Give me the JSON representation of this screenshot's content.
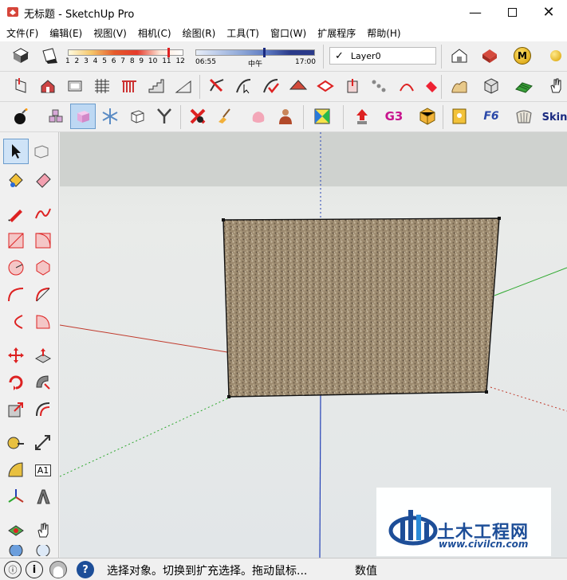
{
  "window": {
    "title": "无标题 - SketchUp Pro",
    "minimize_icon": "minimize-icon",
    "maximize_icon": "maximize-icon",
    "close_icon": "close-icon"
  },
  "menu": {
    "items": [
      "文件(F)",
      "编辑(E)",
      "视图(V)",
      "相机(C)",
      "绘图(R)",
      "工具(T)",
      "窗口(W)",
      "扩展程序",
      "帮助(H)"
    ]
  },
  "shadows": {
    "month_ticks": [
      "1",
      "2",
      "3",
      "4",
      "5",
      "6",
      "7",
      "8",
      "9",
      "10",
      "11",
      "12"
    ],
    "time_start": "06:55",
    "time_mid": "中午",
    "time_end": "17:00"
  },
  "layers": {
    "current": "Layer0",
    "checked": true
  },
  "toolbar_badges": {
    "m_badge": "M",
    "skin_badge": "Skin",
    "g3_badge": "G3",
    "f6_badge": "F6"
  },
  "palette": {
    "text_tool_label": "A1"
  },
  "status": {
    "message": "选择对象。切换到扩充选择。拖动鼠标...",
    "measure_label": "数值"
  },
  "watermark": {
    "title": "土木工程网",
    "url": "www.civilcn.com"
  },
  "colors": {
    "axis_red": "#c0392b",
    "axis_green": "#2ea82e",
    "axis_blue": "#2340b5",
    "brand_blue": "#1d4e98",
    "face_texture": "#9d8b70"
  }
}
